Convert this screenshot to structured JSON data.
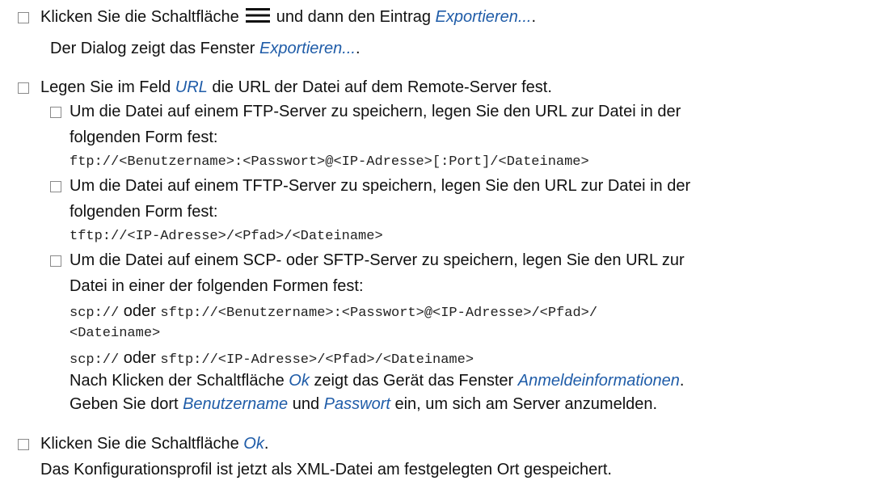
{
  "step1": {
    "text_a": "Klicken Sie die Schaltfläche",
    "text_b": "und dann den Eintrag",
    "entry": "Exportieren...",
    "text_c": ".",
    "result_a": "Der Dialog zeigt das Fenster",
    "result_entry": "Exportieren...",
    "result_c": ".",
    "icon": "hamburger-menu-icon"
  },
  "step2": {
    "text_a": "Legen Sie im Feld",
    "field": "URL",
    "text_b": "die URL der Datei auf dem Remote-Server fest.",
    "ftp": {
      "line1": "Um die Datei auf einem FTP-Server zu speichern, legen Sie den URL zur Datei in der",
      "line2": "folgenden Form fest:",
      "code": "ftp://<Benutzername>:<Passwort>@<IP-Adresse>[:Port]/<Dateiname>"
    },
    "tftp": {
      "line1": "Um die Datei auf einem TFTP-Server zu speichern, legen Sie den URL zur Datei in der",
      "line2": "folgenden Form fest:",
      "code": "tftp://<IP-Adresse>/<Pfad>/<Dateiname>"
    },
    "scp": {
      "line1": "Um die Datei auf einem SCP- oder SFTP-Server zu speichern, legen Sie den URL zur",
      "line2": "Datei in einer der folgenden Formen fest:",
      "code1_a": "scp://",
      "oder": "oder",
      "code1_b": "sftp://<Benutzername>:<Passwort>@<IP-Adresse>/<Pfad>/",
      "code1_c": "<Dateiname>",
      "code2_a": "scp://",
      "code2_b": "sftp://<IP-Adresse>/<Pfad>/<Dateiname>",
      "note1_a": "Nach Klicken der Schaltfläche",
      "note1_ok": "Ok",
      "note1_b": "zeigt das Gerät das Fenster",
      "note1_win": "Anmeldeinformationen",
      "note1_c": ".",
      "note2_a": "Geben Sie dort",
      "note2_user": "Benutzername",
      "note2_und": "und",
      "note2_pass": "Passwort",
      "note2_b": "ein, um sich am Server anzumelden."
    }
  },
  "step3": {
    "text_a": "Klicken Sie die Schaltfläche",
    "ok": "Ok",
    "text_c": ".",
    "result": "Das Konfigurationsprofil ist jetzt als XML-Datei am festgelegten Ort gespeichert."
  },
  "colors": {
    "link_italic": "#1f5ca8",
    "text": "#111111",
    "checkbox_border": "#8a8a8a"
  }
}
